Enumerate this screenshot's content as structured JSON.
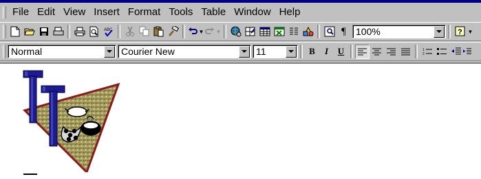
{
  "menu": {
    "items": [
      "File",
      "Edit",
      "View",
      "Insert",
      "Format",
      "Tools",
      "Table",
      "Window",
      "Help"
    ]
  },
  "standard_toolbar": {
    "zoom": "100%",
    "buttons": [
      "new-document",
      "open",
      "save",
      "print",
      "print-preview",
      "spelling",
      "cut",
      "copy",
      "paste",
      "format-painter",
      "undo",
      "redo",
      "web-toolbar",
      "tables-and-borders",
      "insert-table",
      "insert-excel-worksheet",
      "columns",
      "drawing",
      "document-map",
      "show-hide",
      "help"
    ]
  },
  "formatting_toolbar": {
    "style": "Normal",
    "font": "Courier New",
    "size": "11",
    "bold": "B",
    "italic": "I",
    "underline": "U"
  },
  "document": {
    "logo_letters": "TT"
  },
  "colors": {
    "titlebar": "#000080",
    "face": "#c0c0c0",
    "logo_letter": "#1c1c8c",
    "logo_triangle_border": "#8b1a1a"
  }
}
